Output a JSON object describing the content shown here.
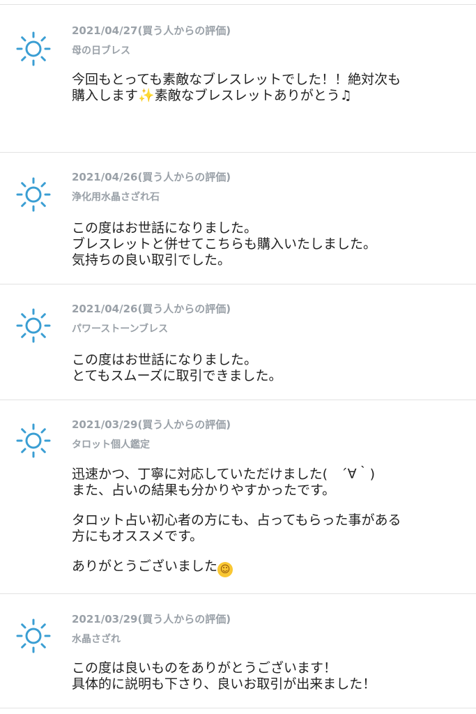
{
  "reviews": [
    {
      "date": "2021/04/27(買う人からの評価)",
      "item": "母の日ブレス",
      "lines": [
        "今回もとっても素敵なブレスレットでした！！絶対次も",
        "購入します",
        "素敵なブレスレットありがとう"
      ],
      "emoji_sparkles": "✨",
      "emoji_note": "♫"
    },
    {
      "date": "2021/04/26(買う人からの評価)",
      "item": "浄化用水晶さざれ石",
      "lines": [
        "この度はお世話になりました。",
        "ブレスレットと併せてこちらも購入いたしました。",
        "気持ちの良い取引でした。"
      ]
    },
    {
      "date": "2021/04/26(買う人からの評価)",
      "item": "パワーストーンブレス",
      "lines": [
        "この度はお世話になりました。",
        "とてもスムーズに取引できました。"
      ]
    },
    {
      "date": "2021/03/29(買う人からの評価)",
      "item": "タロット個人鑑定",
      "lines": [
        "迅速かつ、丁寧に対応していただけました(　´∀｀)",
        "また、占いの結果も分かりやすかったです。",
        "タロット占い初心者の方にも、占ってもらった事がある",
        "方にもオススメです。",
        "ありがとうございました"
      ],
      "emoji_smile": "☺"
    },
    {
      "date": "2021/03/29(買う人からの評価)",
      "item": "水晶さざれ",
      "lines": [
        "この度は良いものをありがとうございます！",
        "具体的に説明も下さり、良いお取引が出来ました！"
      ]
    }
  ],
  "icon": "sun-icon",
  "colors": {
    "icon": "#3a9ed3",
    "meta_text": "#9aa1a8",
    "body_text": "#222222",
    "divider": "#e2e2e2"
  }
}
